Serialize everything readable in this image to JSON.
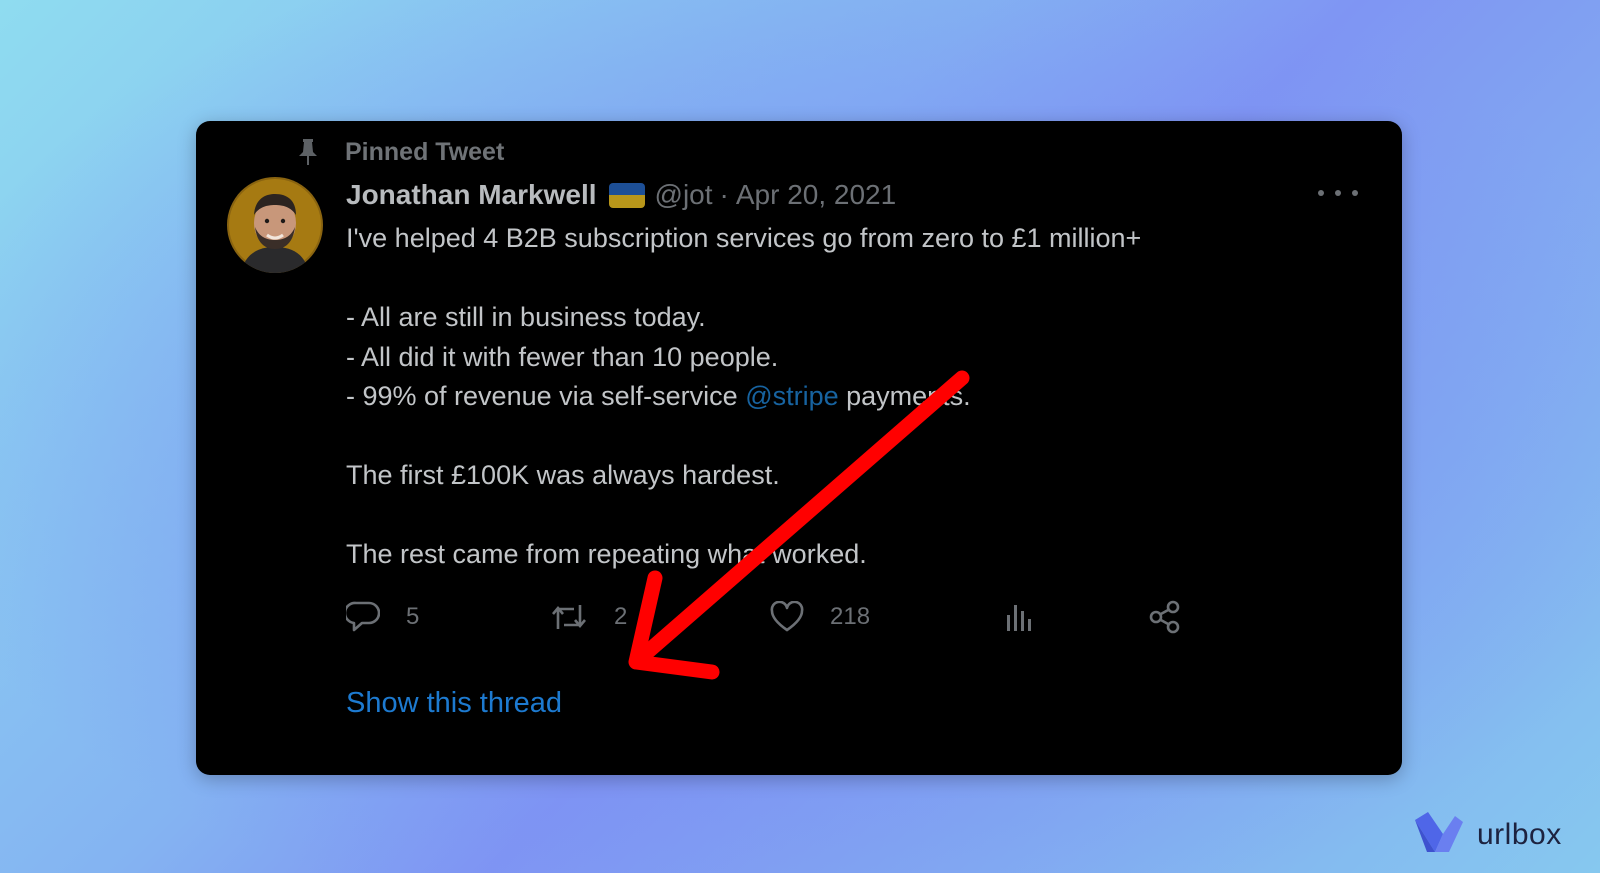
{
  "tweet": {
    "pinned_label": "Pinned Tweet",
    "author_name": "Jonathan Markwell",
    "handle": "@jot",
    "separator": "·",
    "date": "Apr 20, 2021",
    "lines": [
      "I've helped 4 B2B subscription services go from zero to £1 million+",
      "",
      "- All are still in business today.",
      "- All did it with fewer than 10 people.",
      "",
      "",
      "The first £100K was always hardest.",
      "",
      "The rest came from repeating what worked."
    ],
    "revenue_line": {
      "before": "- 99% of revenue via self-service ",
      "mention": "@stripe",
      "after": " payments."
    },
    "counts": {
      "replies": "5",
      "retweets": "2",
      "likes": "218"
    },
    "show_thread": "Show this thread"
  },
  "icons": [
    "pin-icon",
    "more-icon",
    "reply-icon",
    "retweet-icon",
    "like-icon",
    "views-icon",
    "share-icon",
    "urlbox-logo-icon"
  ],
  "annotation": {
    "color": "#ff0000"
  },
  "branding": {
    "name": "urlbox"
  }
}
